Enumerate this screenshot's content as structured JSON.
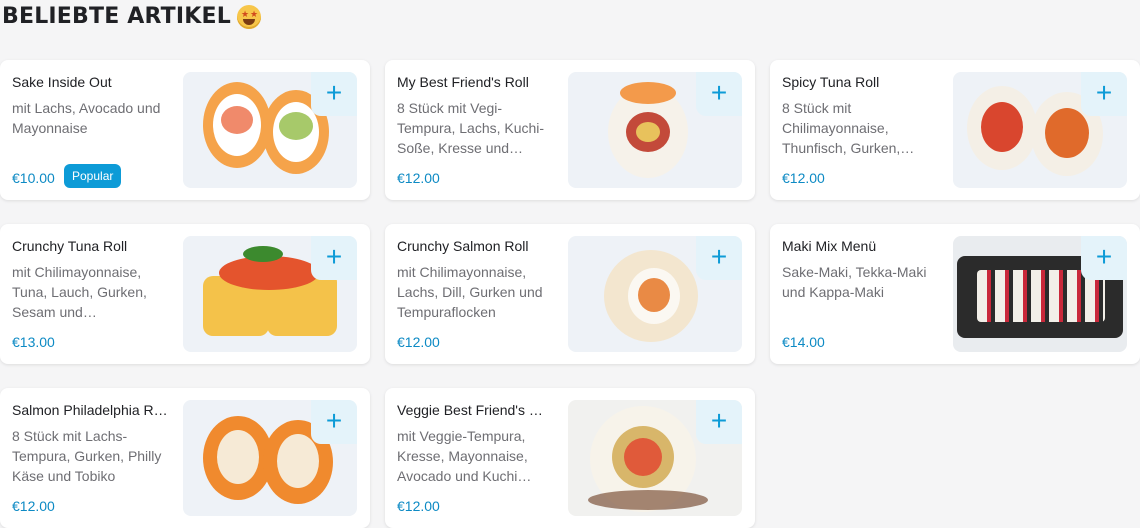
{
  "section_title": "BELIEBTE ARTIKEL",
  "add_symbol": "+",
  "items": [
    {
      "name": "Sake Inside Out",
      "description": "mit Lachs, Avocado und Mayonnaise",
      "price": "€10.00",
      "badge": "Popular"
    },
    {
      "name": "My Best Friend's Roll",
      "description": "8 Stück mit Vegi-Tempura, Lachs, Kuchi-Soße, Kresse und…",
      "price": "€12.00"
    },
    {
      "name": "Spicy Tuna Roll",
      "description": "8 Stück mit Chilimayonnaise, Thunfisch, Gurken,…",
      "price": "€12.00"
    },
    {
      "name": "Crunchy Tuna Roll",
      "description": "mit Chilimayonnaise, Tuna, Lauch, Gurken, Sesam und…",
      "price": "€13.00"
    },
    {
      "name": "Crunchy Salmon Roll",
      "description": "mit Chilimayonnaise, Lachs, Dill, Gurken und Tempuraflocken",
      "price": "€12.00"
    },
    {
      "name": "Maki Mix Menü",
      "description": "Sake-Maki, Tekka-Maki und Kappa-Maki",
      "price": "€14.00"
    },
    {
      "name": "Salmon Philadelphia R…",
      "description": "8 Stück mit Lachs-Tempura, Gurken, Philly Käse und Tobiko",
      "price": "€12.00"
    },
    {
      "name": "Veggie Best Friend's …",
      "description": "mit Veggie-Tempura, Kresse, Mayonnaise, Avocado und Kuchi…",
      "price": "€12.00"
    }
  ]
}
